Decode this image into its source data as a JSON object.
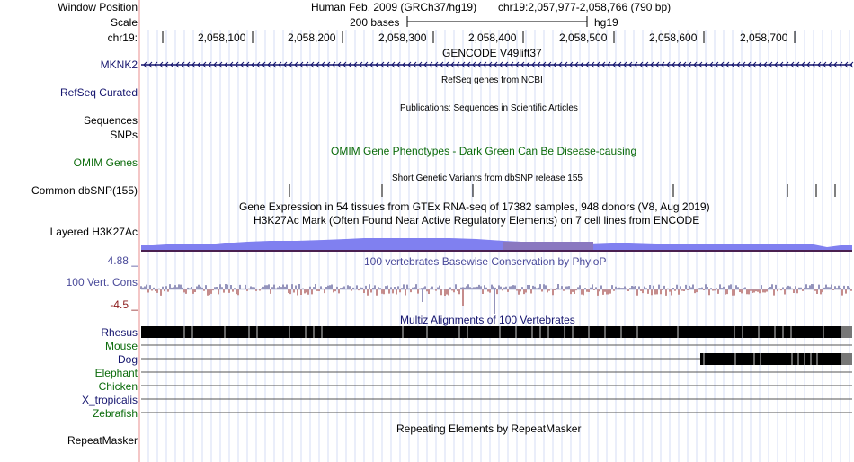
{
  "header": {
    "window_position_label": "Window Position",
    "scale_label": "Scale",
    "chrom_label": "chr19:",
    "assembly": "Human Feb. 2009 (GRCh37/hg19)",
    "position": "chr19:2,057,977-2,058,766 (790 bp)",
    "scale_text": "200 bases",
    "scale_db": "hg19",
    "ruler_ticks": [
      "2,058,100",
      "2,058,200",
      "2,058,300",
      "2,058,400",
      "2,058,500",
      "2,058,600",
      "2,058,700"
    ]
  },
  "tracks": {
    "gencode": {
      "title": "GENCODE V49lift37",
      "feature": "MKNK2"
    },
    "refseq": {
      "label": "RefSeq Curated",
      "title": "RefSeq genes from NCBI"
    },
    "publications": {
      "label": "Sequences",
      "title": "Publications: Sequences in Scientific Articles"
    },
    "snps_label": "SNPs",
    "omim": {
      "label": "OMIM Genes",
      "title": "OMIM Gene Phenotypes - Dark Green Can Be Disease-causing"
    },
    "dbsnp": {
      "label": "Common dbSNP(155)",
      "title": "Short Genetic Variants from dbSNP release 155"
    },
    "gtex": {
      "title": "Gene Expression in 54 tissues from GTEx RNA-seq of 17382 samples, 948 donors (V8, Aug 2019)"
    },
    "h3k27ac": {
      "label": "Layered H3K27Ac",
      "title": "H3K27Ac Mark (Often Found Near Active Regulatory Elements) on 7 cell lines from ENCODE"
    },
    "conservation": {
      "title": "100 vertebrates Basewise Conservation by PhyloP",
      "label": "100 Vert. Cons",
      "ymax": "4.88 _",
      "ymin": "-4.5 _"
    },
    "multiz": {
      "title": "Multiz Alignments of 100 Vertebrates",
      "species": [
        "Rhesus",
        "Mouse",
        "Dog",
        "Elephant",
        "Chicken",
        "X_tropicalis",
        "Zebrafish"
      ]
    },
    "repeatmasker": {
      "label": "RepeatMasker",
      "title": "Repeating Elements by RepeatMasker"
    }
  },
  "colors": {
    "navy": "#14146e",
    "green": "#0b6b0b",
    "h3k27ac_fill": "#8080f0",
    "cons_pos": "#2a2a7a",
    "cons_neg": "#8b1a1a",
    "separator": "#f4c7c7"
  }
}
